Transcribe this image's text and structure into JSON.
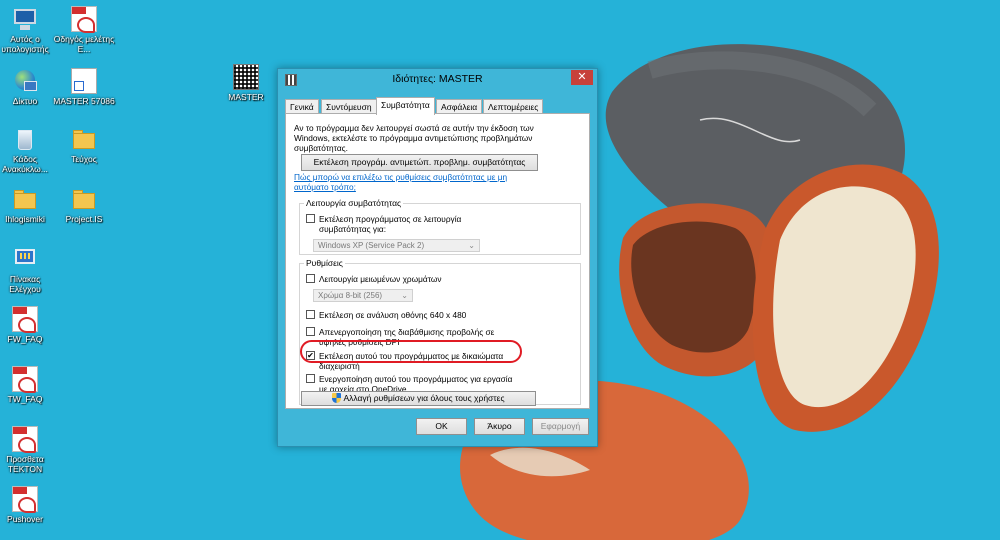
{
  "desktop": {
    "background_color": "#25b2d8",
    "icons": [
      {
        "label": "Αυτός ο υπολογιστής",
        "icon": "computer-icon"
      },
      {
        "label": "Οδηγός μελέτης Ε...",
        "icon": "pdf-icon"
      },
      {
        "label": "Δίκτυο",
        "icon": "network-icon"
      },
      {
        "label": "MASTER 57086",
        "icon": "file-shortcut-icon"
      },
      {
        "label": "Κάδος Ανακύκλω...",
        "icon": "recycle-bin-icon"
      },
      {
        "label": "Τεύχος",
        "icon": "folder-icon"
      },
      {
        "label": "Ihlogismiki",
        "icon": "folder-icon"
      },
      {
        "label": "Project.IS",
        "icon": "folder-icon"
      },
      {
        "label": "Πίνακας Ελέγχου",
        "icon": "control-panel-icon"
      },
      {
        "label": "FW_FAQ",
        "icon": "pdf-icon"
      },
      {
        "label": "TW_FAQ",
        "icon": "pdf-icon"
      },
      {
        "label": "Προσθετα TEKTON",
        "icon": "pdf-icon"
      },
      {
        "label": "Pushover",
        "icon": "pdf-icon"
      },
      {
        "label": "MASTER",
        "icon": "master-app-icon"
      }
    ]
  },
  "dialog": {
    "title": "Ιδιότητες: MASTER",
    "close_label": "✕",
    "tabs": [
      {
        "label": "Γενικά"
      },
      {
        "label": "Συντόμευση"
      },
      {
        "label": "Συμβατότητα",
        "active": true
      },
      {
        "label": "Ασφάλεια"
      },
      {
        "label": "Λεπτομέρειες"
      }
    ],
    "intro_text": "Αν το πρόγραμμα δεν λειτουργεί σωστά σε αυτήν την έκδοση των Windows, εκτελέστε το πρόγραμμα αντιμετώπισης προβλημάτων συμβατότητας.",
    "troubleshooter_button": "Εκτέλεση προγράμ. αντιμετώπ. προβλημ. συμβατότητας",
    "help_link": "Πώς μπορώ να επιλέξω τις ρυθμίσεις συμβατότητας με μη αυτόματο τρόπο;",
    "compat_mode": {
      "group_title": "Λειτουργία συμβατότητας",
      "checkbox_label": "Εκτέλεση προγράμματος σε λειτουργία συμβατότητας για:",
      "checked": false,
      "os_select_value": "Windows XP (Service Pack 2)"
    },
    "settings": {
      "group_title": "Ρυθμίσεις",
      "reduced_color": {
        "label": "Λειτουργία μειωμένων χρωμάτων",
        "checked": false
      },
      "color_select_value": "Χρώμα 8-bit (256)",
      "res_640": {
        "label": "Εκτέλεση σε ανάλυση οθόνης 640 x 480",
        "checked": false
      },
      "disable_dpi": {
        "label": "Απενεργοποίηση της διαβάθμισης προβολής σε υψηλές ρυθμίσεις DPI",
        "checked": false
      },
      "run_as_admin": {
        "label": "Εκτέλεση αυτού του προγράμματος με δικαιώματα διαχειριστή",
        "checked": true,
        "mark": "✔"
      },
      "onedrive": {
        "label": "Ενεργοποίηση αυτού του προγράμματος για εργασία με αρχεία στο OneDrive",
        "checked": false
      }
    },
    "all_users_button": "Αλλαγή ρυθμίσεων για όλους τους χρήστες",
    "ok_button": "OK",
    "cancel_button": "Άκυρο",
    "apply_button": "Εφαρμογή",
    "highlight_color": "#e01b24"
  }
}
